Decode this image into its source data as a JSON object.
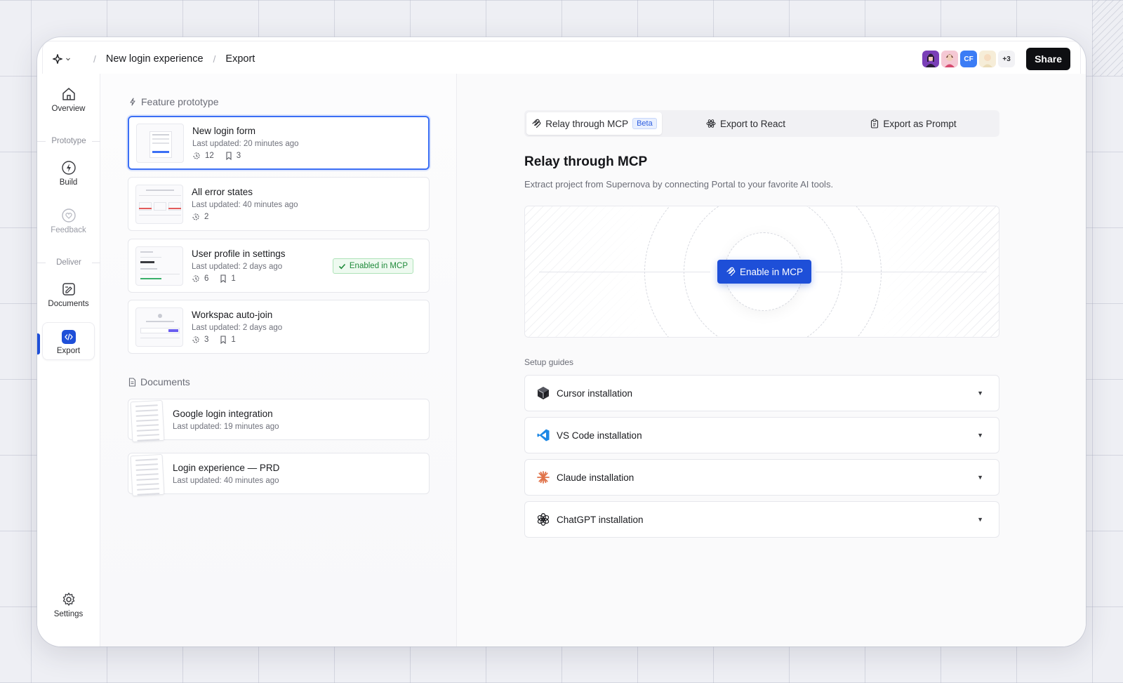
{
  "breadcrumb": {
    "project": "New login experience",
    "page": "Export"
  },
  "header": {
    "avatars_more": "+3",
    "avatar_initials": "CF",
    "share_label": "Share"
  },
  "nav": {
    "overview": "Overview",
    "group_prototype": "Prototype",
    "build": "Build",
    "feedback": "Feedback",
    "group_deliver": "Deliver",
    "documents": "Documents",
    "export": "Export",
    "settings": "Settings"
  },
  "list": {
    "feature_title": "Feature prototype",
    "items": [
      {
        "title": "New login form",
        "updated": "Last updated: 20 minutes ago",
        "revisions": "12",
        "bookmarks": "3"
      },
      {
        "title": "All error states",
        "updated": "Last updated: 40 minutes ago",
        "revisions": "2"
      },
      {
        "title": "User profile in settings",
        "updated": "Last updated: 2 days ago",
        "revisions": "6",
        "bookmarks": "1",
        "badge": "Enabled in MCP"
      },
      {
        "title": "Workspac auto-join",
        "updated": "Last updated: 2 days ago",
        "revisions": "3",
        "bookmarks": "1"
      }
    ],
    "documents_title": "Documents",
    "documents": [
      {
        "title": "Google login integration",
        "updated": "Last updated: 19 minutes ago"
      },
      {
        "title": "Login experience — PRD",
        "updated": "Last updated: 40 minutes ago"
      }
    ]
  },
  "export": {
    "tabs": [
      {
        "label": "Relay through MCP",
        "badge": "Beta"
      },
      {
        "label": "Export to React"
      },
      {
        "label": "Export as Prompt"
      }
    ],
    "title": "Relay through MCP",
    "description": "Extract project from Supernova by connecting Portal to your favorite AI tools.",
    "enable_label": "Enable in MCP",
    "setup_label": "Setup guides",
    "guides": [
      {
        "label": "Cursor installation",
        "icon": "cursor-icon"
      },
      {
        "label": "VS Code installation",
        "icon": "vscode-icon"
      },
      {
        "label": "Claude installation",
        "icon": "claude-icon"
      },
      {
        "label": "ChatGPT installation",
        "icon": "chatgpt-icon"
      }
    ]
  },
  "colors": {
    "accent": "#1e4fd8",
    "selected_border": "#3b6ff5",
    "success": "#1f8a3a",
    "vscode": "#1e88e5",
    "claude": "#e0734a"
  }
}
